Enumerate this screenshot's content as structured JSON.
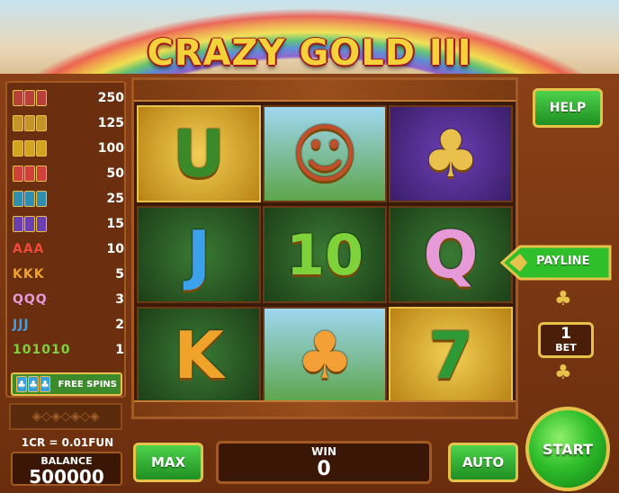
{
  "game": {
    "title": "CRAZY GOLD III"
  },
  "paytable": {
    "rows": [
      {
        "symbol": "leprechaun",
        "value": "250",
        "type": "icon",
        "color": "#b8403a"
      },
      {
        "symbol": "horseshoe",
        "value": "125",
        "type": "icon",
        "color": "#c4962a"
      },
      {
        "symbol": "seven",
        "value": "100",
        "type": "icon",
        "color": "#d1a51f"
      },
      {
        "symbol": "mushroom",
        "value": "50",
        "type": "icon",
        "color": "#d0413b"
      },
      {
        "symbol": "hat",
        "value": "25",
        "type": "icon",
        "color": "#2e8fb0"
      },
      {
        "symbol": "pot",
        "value": "15",
        "type": "icon",
        "color": "#6a3fb0"
      },
      {
        "symbol": "A",
        "value": "10",
        "type": "letters",
        "letters": "AAA",
        "color": "#ef4a3a"
      },
      {
        "symbol": "K",
        "value": "5",
        "type": "letters",
        "letters": "KKK",
        "color": "#f0a32a"
      },
      {
        "symbol": "Q",
        "value": "3",
        "type": "letters",
        "letters": "QQQ",
        "color": "#e79ad8"
      },
      {
        "symbol": "J",
        "value": "2",
        "type": "letters",
        "letters": "JJJ",
        "color": "#3da0ea"
      },
      {
        "symbol": "10",
        "value": "1",
        "type": "letters",
        "letters": "101010",
        "color": "#7ed23a"
      }
    ],
    "free_spins_label": "FREE SPINS"
  },
  "reels": {
    "cells": [
      {
        "symbol": "horseshoe-icon",
        "style": "cell-gold",
        "glyph": "U",
        "color": "#3a8a2a"
      },
      {
        "symbol": "leprechaun-icon",
        "style": "cell-sky",
        "glyph": "☺",
        "color": "#c0502a"
      },
      {
        "symbol": "pot-of-gold-icon",
        "style": "cell-purple",
        "glyph": "♣",
        "color": "#e8c04b"
      },
      {
        "symbol": "J",
        "style": "cell-green",
        "glyph": "J",
        "color": "#3da0ea"
      },
      {
        "symbol": "10",
        "style": "cell-green",
        "glyph": "10",
        "color": "#7ed23a"
      },
      {
        "symbol": "Q",
        "style": "cell-green",
        "glyph": "Q",
        "color": "#e79ad8"
      },
      {
        "symbol": "K",
        "style": "cell-green",
        "glyph": "K",
        "color": "#f0a32a"
      },
      {
        "symbol": "hat-icon",
        "style": "cell-sky",
        "glyph": "♣",
        "color": "#f5a037"
      },
      {
        "symbol": "seven-icon",
        "style": "cell-gold",
        "glyph": "7",
        "color": "#2e9a35"
      }
    ]
  },
  "controls": {
    "help_label": "HELP",
    "payline_label": "PAYLINE",
    "bet_value": "1",
    "bet_label": "BET",
    "max_label": "MAX",
    "auto_label": "AUTO",
    "start_label": "START"
  },
  "footer": {
    "credit_rate": "1CR = 0.01FUN",
    "balance_label": "BALANCE",
    "balance_value": "500000",
    "win_label": "WIN",
    "win_value": "0"
  },
  "colors": {
    "button_green": "#2fbf2b",
    "gold_border": "#e6c24a",
    "frame_brown": "#6a2e0e"
  }
}
